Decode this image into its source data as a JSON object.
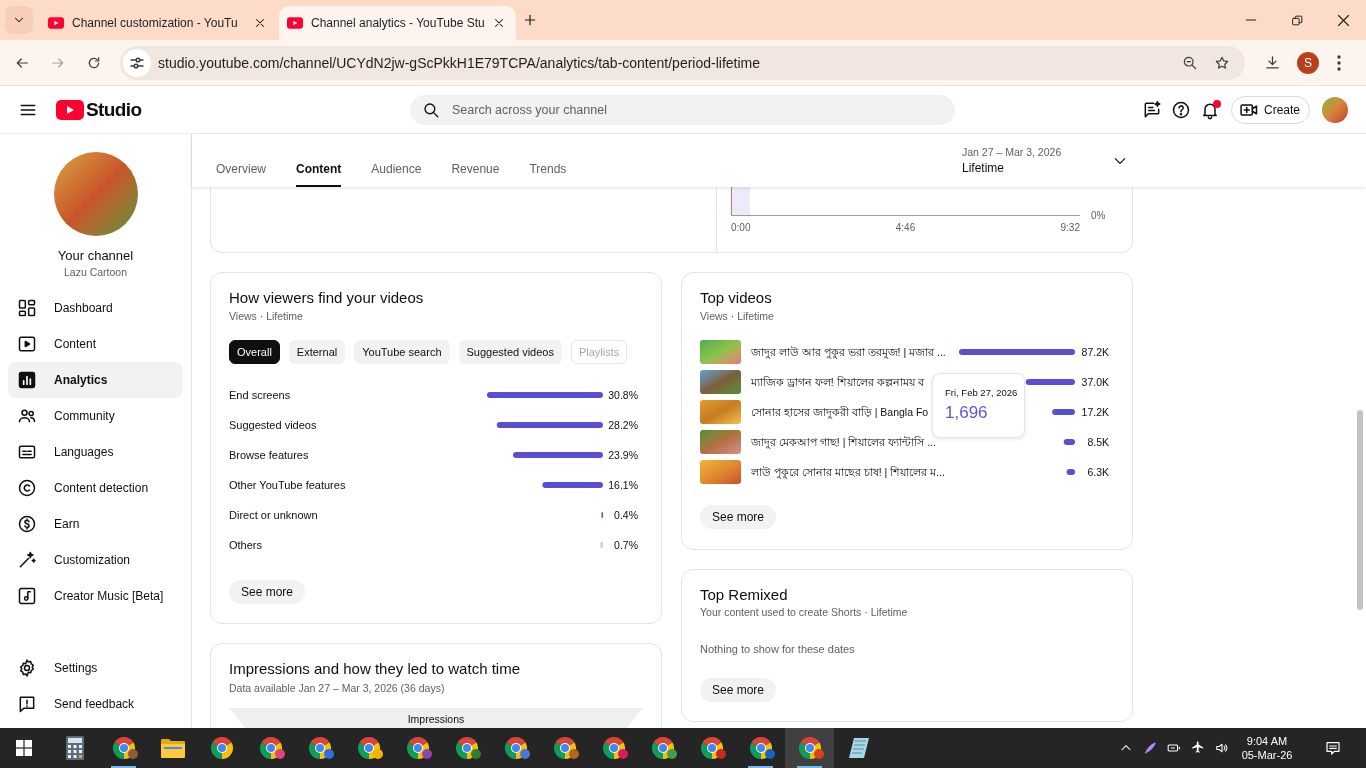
{
  "browser": {
    "tabs": [
      {
        "title": "Channel customization - YouTu",
        "selected": false
      },
      {
        "title": "Channel analytics - YouTube Stu",
        "selected": true
      }
    ],
    "url": "studio.youtube.com/channel/UCYdN2jw-gScPkkH1E79TCPA/analytics/tab-content/period-lifetime",
    "profile_initial": "S"
  },
  "header": {
    "logo_text": "Studio",
    "search": {
      "placeholder": "Search across your channel"
    },
    "notifications_unread": true,
    "create_label": "Create"
  },
  "sidebar": {
    "channel_label": "Your channel",
    "channel_name": "Lazu Cartoon",
    "items": [
      {
        "label": "Dashboard",
        "selected": false
      },
      {
        "label": "Content",
        "selected": false
      },
      {
        "label": "Analytics",
        "selected": true
      },
      {
        "label": "Community",
        "selected": false
      },
      {
        "label": "Languages",
        "selected": false
      },
      {
        "label": "Content detection",
        "selected": false
      },
      {
        "label": "Earn",
        "selected": false
      },
      {
        "label": "Customization",
        "selected": false
      },
      {
        "label": "Creator Music [Beta]",
        "selected": false
      }
    ],
    "footer_items": [
      {
        "label": "Settings"
      },
      {
        "label": "Send feedback"
      }
    ]
  },
  "analytics_tabs": [
    {
      "label": "Overview",
      "selected": false
    },
    {
      "label": "Content",
      "selected": true
    },
    {
      "label": "Audience",
      "selected": false
    },
    {
      "label": "Revenue",
      "selected": false
    },
    {
      "label": "Trends",
      "selected": false
    }
  ],
  "date_range": {
    "range": "Jan 27 – Mar 3, 2026",
    "period": "Lifetime"
  },
  "retention_chart": {
    "x_labels": [
      "0:00",
      "4:46",
      "9:32"
    ],
    "y_labels": [
      "0%"
    ]
  },
  "traffic_sources": {
    "title": "How viewers find your videos",
    "subtitle": "Views · Lifetime",
    "filters": [
      {
        "label": "Overall",
        "selected": true,
        "disabled": false
      },
      {
        "label": "External",
        "selected": false,
        "disabled": false
      },
      {
        "label": "YouTube search",
        "selected": false,
        "disabled": false
      },
      {
        "label": "Suggested videos",
        "selected": false,
        "disabled": false
      },
      {
        "label": "Playlists",
        "selected": false,
        "disabled": true
      }
    ],
    "chart_data": {
      "type": "bar",
      "orientation": "horizontal",
      "stacked": true,
      "categories": [
        "End screens",
        "Suggested videos",
        "Browse features",
        "Other YouTube features",
        "Direct or unknown",
        "Others"
      ],
      "series": [
        {
          "color": "#5b4fd1",
          "values": [
            30.8,
            28.2,
            23.9,
            16.1,
            0.4,
            null
          ],
          "value_labels": [
            "30.8%",
            "28.2%",
            "23.9%",
            "16.1%",
            "0.4%",
            null
          ]
        },
        {
          "color": "#d0d0d0",
          "values": [
            null,
            null,
            null,
            null,
            null,
            0.7
          ],
          "value_labels": [
            null,
            null,
            null,
            null,
            null,
            "0.7%"
          ]
        }
      ]
    },
    "see_more": "See more"
  },
  "top_videos": {
    "title": "Top videos",
    "subtitle": "Views · Lifetime",
    "chart_data": {
      "type": "bar",
      "orientation": "horizontal",
      "categories": [
        "জাদুর লাউ আর পুকুর ভরা তরমুজ! | মজার ...",
        "ম্যাজিক ড্রাগন ফল! শিয়ালের কল্পনাময় ব",
        "সোনার হাসের জাদুকরী বাড়ি | Bangla Fo",
        "জাদুর মেকআপ গাছ! | শিয়ালের ফ্যান্টাসি ...",
        "লাউ পুকুরে সোনার মাছের চাষ! | শিয়ালের ম..."
      ],
      "series": [
        {
          "color": "#5b4fd1",
          "values": [
            87200,
            37000,
            17200,
            8500,
            6300
          ],
          "value_labels": [
            "87.2K",
            "37.0K",
            "17.2K",
            "8.5K",
            "6.3K"
          ]
        }
      ]
    },
    "see_more": "See more"
  },
  "hover_tooltip": {
    "date": "Fri, Feb 27, 2026",
    "value": "1,696"
  },
  "top_remixed": {
    "title": "Top Remixed",
    "subtitle": "Your content used to create Shorts · Lifetime",
    "empty_message": "Nothing to show for these dates",
    "see_more": "See more"
  },
  "impressions": {
    "title": "Impressions and how they led to watch time",
    "subtitle": "Data available Jan 27 – Mar 3, 2026 (36 days)",
    "funnel_label": "Impressions"
  },
  "taskbar": {
    "apps": [
      {
        "kind": "calculator",
        "running": false,
        "selected": false
      },
      {
        "kind": "browser",
        "running": true,
        "selected": false,
        "color": "#8d5a3b"
      },
      {
        "kind": "files",
        "running": false,
        "selected": false
      },
      {
        "kind": "browser",
        "running": false,
        "selected": false
      },
      {
        "kind": "browser",
        "running": false,
        "selected": false,
        "color": "#e0457b"
      },
      {
        "kind": "browser",
        "running": false,
        "selected": false,
        "color": "#2f6fde"
      },
      {
        "kind": "browser",
        "running": false,
        "selected": false,
        "color": "#f4b400"
      },
      {
        "kind": "browser",
        "running": false,
        "selected": false,
        "color": "#8e44ad"
      },
      {
        "kind": "browser",
        "running": false,
        "selected": false,
        "color": "#2e7d32"
      },
      {
        "kind": "browser",
        "running": false,
        "selected": false,
        "color": "#4a77d4"
      },
      {
        "kind": "browser",
        "running": false,
        "selected": false,
        "color": "#b5651d"
      },
      {
        "kind": "browser",
        "running": false,
        "selected": false,
        "color": "#d81b60"
      },
      {
        "kind": "browser",
        "running": false,
        "selected": false,
        "color": "#43a047"
      },
      {
        "kind": "browser",
        "running": false,
        "selected": false,
        "color": "#c62828"
      },
      {
        "kind": "browser",
        "running": true,
        "selected": false,
        "color": "#1565c0"
      },
      {
        "kind": "browser",
        "running": true,
        "selected": true,
        "color": "#d84315"
      },
      {
        "kind": "notepad",
        "running": false,
        "selected": false
      }
    ],
    "time": "9:04 AM",
    "date": "05-Mar-26"
  }
}
